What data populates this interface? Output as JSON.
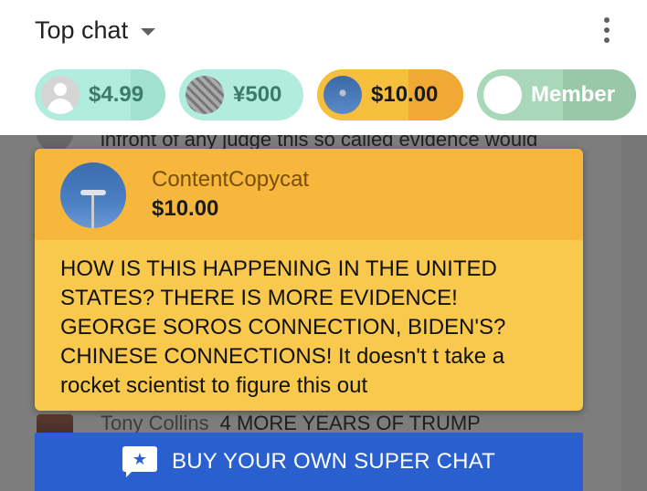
{
  "header": {
    "chat_mode_label": "Top chat",
    "more_menu_icon": "more-vert-icon"
  },
  "tickers": [
    {
      "amount": "$4.99",
      "avatar": "default-user-avatar",
      "color": "#b1ecdd"
    },
    {
      "amount": "¥500",
      "avatar": "pattern-avatar",
      "color": "#b1ecdd"
    },
    {
      "amount": "$10.00",
      "avatar": "windmill-avatar",
      "color": "#f6bf3e"
    },
    {
      "amount": "Member",
      "avatar": "white-avatar",
      "color": "#a9d7b9"
    }
  ],
  "background_chat": {
    "top_message_fragment": "infront of any judge this so called evidence would",
    "bottom_author": "Tony Collins",
    "bottom_message": "4 MORE YEARS OF TRUMP"
  },
  "superchat": {
    "author": "ContentCopycat",
    "amount": "$10.00",
    "message": "HOW IS THIS HAPPENING IN THE UNITED STATES? THERE IS MORE EVIDENCE! GEORGE SOROS CONNECTION, BIDEN'S? CHINESE CONNECTIONS! It doesn't t take a rocket scientist to figure this out",
    "header_color": "#f6b73c",
    "body_color": "#f8c94c"
  },
  "buy_button": {
    "label": "BUY YOUR OWN SUPER CHAT",
    "icon": "superchat-star-icon",
    "color": "#2a5fcf"
  }
}
